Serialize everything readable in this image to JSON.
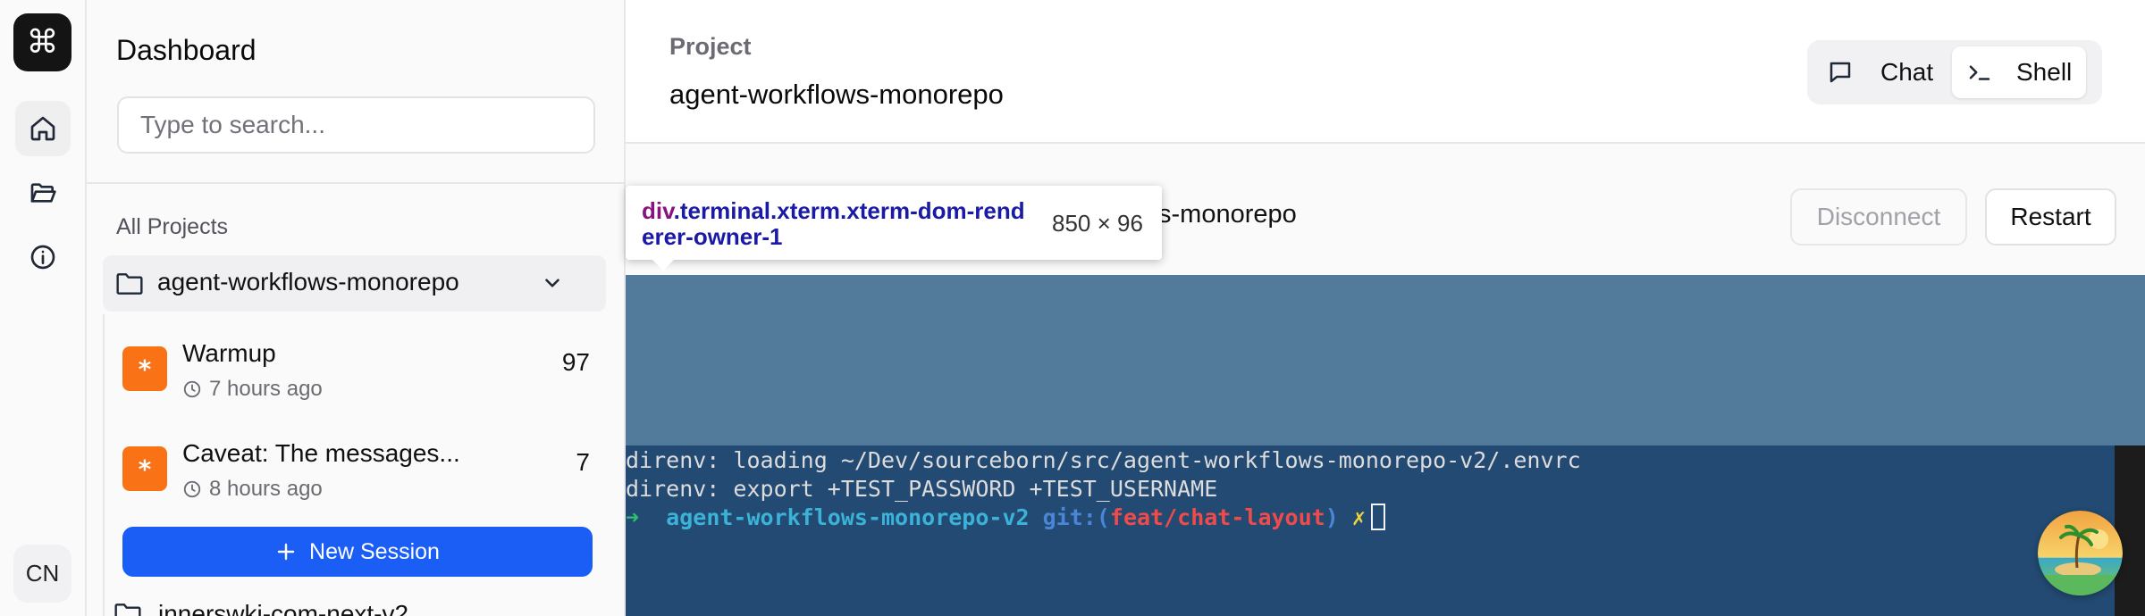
{
  "rail": {
    "logo_glyph": "⌘",
    "items": [
      {
        "name": "home",
        "icon": "home-icon",
        "active": true
      },
      {
        "name": "projects",
        "icon": "folder-open-icon",
        "active": false
      },
      {
        "name": "info",
        "icon": "info-icon",
        "active": false
      }
    ],
    "avatar_initials": "CN"
  },
  "sidebar": {
    "title": "Dashboard",
    "search_placeholder": "Type to search...",
    "section_label": "All Projects",
    "project": {
      "name": "agent-workflows-monorepo",
      "icon": "folder-icon",
      "expanded": true
    },
    "sessions": [
      {
        "title": "Warmup",
        "time": "7 hours ago",
        "count": "97",
        "badge": "*"
      },
      {
        "title": "Caveat: The messages...",
        "time": "8 hours ago",
        "count": "7",
        "badge": "*"
      }
    ],
    "new_session_label": "New Session",
    "next_project": {
      "name": "innerswki-com-next-v2"
    }
  },
  "header": {
    "label": "Project",
    "project_name": "agent-workflows-monorepo",
    "tabs": [
      {
        "label": "Chat",
        "icon": "message-square-icon",
        "active": false
      },
      {
        "label": "Shell",
        "icon": "terminal-icon",
        "active": true
      }
    ]
  },
  "shell": {
    "path_visible": "s-monorepo",
    "disconnect_label": "Disconnect",
    "restart_label": "Restart",
    "lines": [
      "direnv: loading ~/Dev/sourceborn/src/agent-workflows-monorepo-v2/.envrc",
      "direnv: export +TEST_PASSWORD +TEST_USERNAME"
    ],
    "prompt": {
      "arrow": "➜",
      "dir": "agent-workflows-monorepo-v2",
      "git_prefix": "git:(",
      "branch": "feat/chat-layout",
      "git_suffix": ")",
      "dirty": "✗"
    }
  },
  "devtools_tooltip": {
    "tag": "div",
    "classes": ".terminal.xterm.xterm-dom-renderer-owner-1",
    "size": "850 × 96"
  },
  "colors": {
    "accent": "#1a5ef5",
    "badge": "#f97316",
    "terminal_bg": "#234a72",
    "highlight": "#527a9b"
  }
}
